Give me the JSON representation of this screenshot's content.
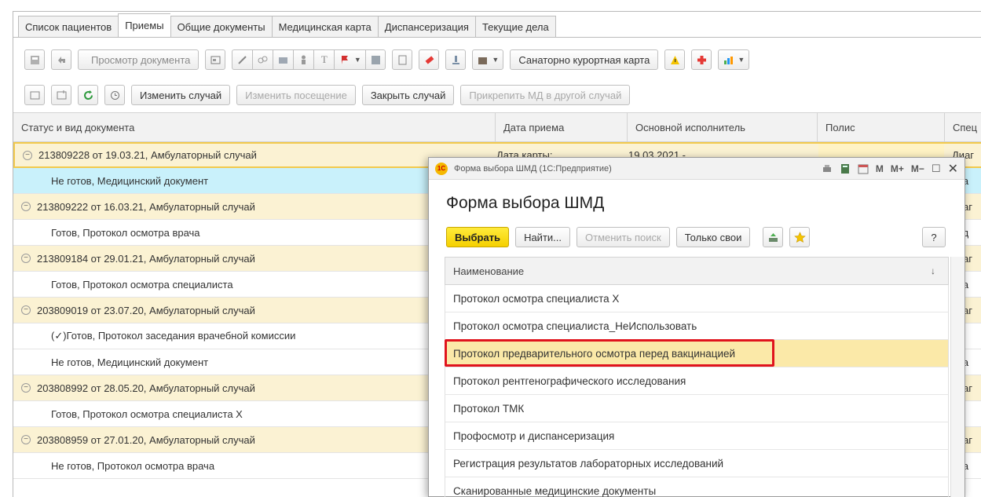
{
  "tabs": [
    "Список пациентов",
    "Приемы",
    "Общие документы",
    "Медицинская карта",
    "Диспансеризация",
    "Текущие дела"
  ],
  "active_tab": "Приемы",
  "toolbar1": {
    "view_document": "Просмотр документа",
    "sanatorium_card": "Санаторно курортная карта"
  },
  "toolbar2": {
    "change_case": "Изменить случай",
    "change_visit": "Изменить посещение",
    "close_case": "Закрыть случай",
    "attach_md": "Прикрепить МД в другой случай"
  },
  "columns": [
    "Статус и вид документа",
    "Дата приема",
    "Основной исполнитель",
    "Полис",
    "Спец"
  ],
  "rows": [
    {
      "type": "group",
      "text": "213809228 от 19.03.21, Амбулаторный случай",
      "date": "Дата карты:",
      "executor": "19.03.2021 -",
      "spec": "Диаг"
    },
    {
      "type": "child",
      "text": "Не готов, Медицинский документ",
      "spec": "Вра",
      "selected": true
    },
    {
      "type": "group",
      "text": "213809222 от 16.03.21, Амбулаторный случай",
      "spec": "Диаг"
    },
    {
      "type": "child",
      "text": "Готов, Протокол осмотра врача",
      "spec": "Врд"
    },
    {
      "type": "group",
      "text": "213809184 от 29.01.21, Амбулаторный случай",
      "spec": "Диаг"
    },
    {
      "type": "child",
      "text": "Готов, Протокол осмотра специалиста",
      "spec": "Вра"
    },
    {
      "type": "group",
      "text": "203809019 от 23.07.20, Амбулаторный случай",
      "spec": "Диаг"
    },
    {
      "type": "child",
      "text": "(✓)Готов, Протокол заседания врачебной комиссии",
      "spec": ""
    },
    {
      "type": "child",
      "text": "Не готов, Медицинский документ",
      "spec": "Вра"
    },
    {
      "type": "group",
      "text": "203808992 от 28.05.20, Амбулаторный случай",
      "spec": "Диаг"
    },
    {
      "type": "child",
      "text": "Готов, Протокол осмотра специалиста Х",
      "spec": "Вм"
    },
    {
      "type": "group",
      "text": "203808959 от 27.01.20, Амбулаторный случай",
      "spec": "Диаг"
    },
    {
      "type": "child",
      "text": "Не готов, Протокол осмотра врача",
      "spec": "Вра"
    }
  ],
  "dialog": {
    "window_title": "Форма выбора ШМД  (1С:Предприятие)",
    "logo": "1С",
    "heading": "Форма выбора ШМД",
    "btn_select": "Выбрать",
    "btn_find": "Найти...",
    "btn_cancel_search": "Отменить поиск",
    "btn_only_mine": "Только свои",
    "help": "?",
    "column": "Наименование",
    "sort_arrow": "↓",
    "tools": [
      "M",
      "M+",
      "M−"
    ],
    "items": [
      "Протокол осмотра специалиста Х",
      "Протокол осмотра специалиста_НеИспользовать",
      "Протокол предварительного осмотра перед вакцинацией",
      "Протокол рентгенографического исследования",
      "Протокол ТМК",
      "Профосмотр и диспансеризация",
      "Регистрация результатов лабораторных исследований",
      "Сканированные медицинские документы"
    ],
    "highlighted_index": 2
  }
}
